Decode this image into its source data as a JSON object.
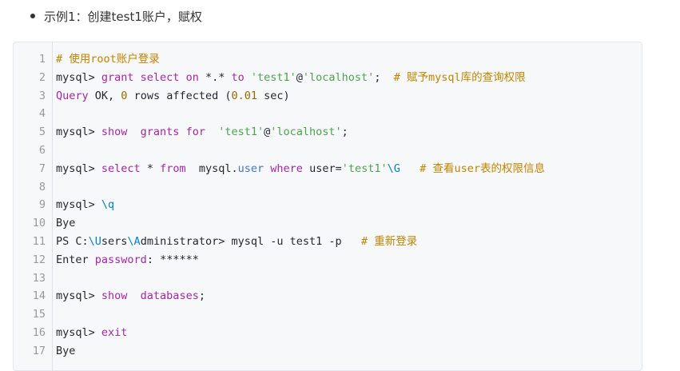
{
  "bullet": {
    "text": "示例1：创建test1账户，赋权"
  },
  "code": {
    "line_numbers": [
      "1",
      "2",
      "3",
      "4",
      "5",
      "6",
      "7",
      "8",
      "9",
      "10",
      "11",
      "12",
      "13",
      "14",
      "15",
      "16",
      "17"
    ],
    "lines": [
      [
        {
          "t": "# 使用root账户登录",
          "c": "cm"
        }
      ],
      [
        {
          "t": "mysql> ",
          "c": ""
        },
        {
          "t": "grant select on ",
          "c": "kw"
        },
        {
          "t": "*.* ",
          "c": ""
        },
        {
          "t": "to ",
          "c": "kw"
        },
        {
          "t": "'test1'",
          "c": "str"
        },
        {
          "t": "@",
          "c": ""
        },
        {
          "t": "'localhost'",
          "c": "str"
        },
        {
          "t": ";  ",
          "c": ""
        },
        {
          "t": "# 赋予mysql库的查询权限",
          "c": "cm"
        }
      ],
      [
        {
          "t": "Query ",
          "c": "kw"
        },
        {
          "t": "OK, ",
          "c": ""
        },
        {
          "t": "0",
          "c": "num"
        },
        {
          "t": " rows affected (",
          "c": ""
        },
        {
          "t": "0.01",
          "c": "num"
        },
        {
          "t": " sec)",
          "c": ""
        }
      ],
      [
        {
          "t": "",
          "c": ""
        }
      ],
      [
        {
          "t": "mysql> ",
          "c": ""
        },
        {
          "t": "show  grants for  ",
          "c": "kw"
        },
        {
          "t": "'test1'",
          "c": "str"
        },
        {
          "t": "@",
          "c": ""
        },
        {
          "t": "'localhost'",
          "c": "str"
        },
        {
          "t": ";",
          "c": ""
        }
      ],
      [
        {
          "t": "",
          "c": ""
        }
      ],
      [
        {
          "t": "mysql> ",
          "c": ""
        },
        {
          "t": "select ",
          "c": "kw"
        },
        {
          "t": "* ",
          "c": ""
        },
        {
          "t": "from  ",
          "c": "kw"
        },
        {
          "t": "mysql.",
          "c": ""
        },
        {
          "t": "user ",
          "c": "fn"
        },
        {
          "t": "where ",
          "c": "kw"
        },
        {
          "t": "user=",
          "c": ""
        },
        {
          "t": "'test1'",
          "c": "str"
        },
        {
          "t": "\\G",
          "c": "esc"
        },
        {
          "t": "   ",
          "c": ""
        },
        {
          "t": "# 查看user表的权限信息",
          "c": "cm"
        }
      ],
      [
        {
          "t": "",
          "c": ""
        }
      ],
      [
        {
          "t": "mysql> ",
          "c": ""
        },
        {
          "t": "\\q",
          "c": "esc"
        }
      ],
      [
        {
          "t": "Bye",
          "c": ""
        }
      ],
      [
        {
          "t": "PS C:",
          "c": ""
        },
        {
          "t": "\\U",
          "c": "esc"
        },
        {
          "t": "sers",
          "c": ""
        },
        {
          "t": "\\A",
          "c": "esc"
        },
        {
          "t": "dministrator> mysql -u test1 -p   ",
          "c": ""
        },
        {
          "t": "# 重新登录",
          "c": "cm"
        }
      ],
      [
        {
          "t": "Enter ",
          "c": ""
        },
        {
          "t": "password",
          "c": "kw"
        },
        {
          "t": ": ******",
          "c": ""
        }
      ],
      [
        {
          "t": "",
          "c": ""
        }
      ],
      [
        {
          "t": "mysql> ",
          "c": ""
        },
        {
          "t": "show  databases",
          "c": "kw"
        },
        {
          "t": ";",
          "c": ""
        }
      ],
      [
        {
          "t": "",
          "c": ""
        }
      ],
      [
        {
          "t": "mysql> ",
          "c": ""
        },
        {
          "t": "exit",
          "c": "kw"
        }
      ],
      [
        {
          "t": "Bye",
          "c": ""
        }
      ]
    ]
  }
}
